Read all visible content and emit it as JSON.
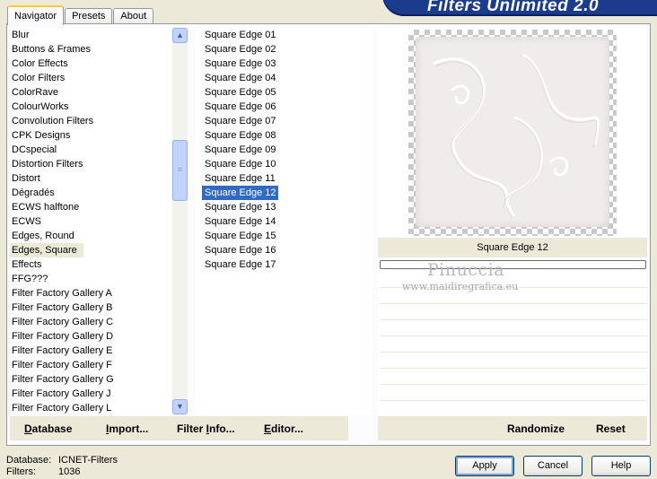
{
  "app": {
    "title": "Filters Unlimited 2.0"
  },
  "tabs": [
    {
      "label": "Navigator",
      "active": true
    },
    {
      "label": "Presets",
      "active": false
    },
    {
      "label": "About",
      "active": false
    }
  ],
  "categories": [
    "Blur",
    "Buttons & Frames",
    "Color Effects",
    "Color Filters",
    "ColorRave",
    "ColourWorks",
    "Convolution Filters",
    "CPK Designs",
    "DCspecial",
    "Distortion Filters",
    "Distort",
    "Dégradés",
    "ECWS halftone",
    "ECWS",
    "Edges, Round",
    "Edges, Square",
    "Effects",
    "FFG???",
    "Filter Factory Gallery A",
    "Filter Factory Gallery B",
    "Filter Factory Gallery C",
    "Filter Factory Gallery D",
    "Filter Factory Gallery E",
    "Filter Factory Gallery F",
    "Filter Factory Gallery G",
    "Filter Factory Gallery J",
    "Filter Factory Gallery L"
  ],
  "selected_category": "Edges, Square",
  "filters": [
    "Square Edge 01",
    "Square Edge 02",
    "Square Edge 03",
    "Square Edge 04",
    "Square Edge 05",
    "Square Edge 06",
    "Square Edge 07",
    "Square Edge 08",
    "Square Edge 09",
    "Square Edge 10",
    "Square Edge 11",
    "Square Edge 12",
    "Square Edge 13",
    "Square Edge 14",
    "Square Edge 15",
    "Square Edge 16",
    "Square Edge 17"
  ],
  "selected_filter": "Square Edge 12",
  "preview": {
    "filter_name": "Square Edge 12"
  },
  "watermark": {
    "name": "Pinuccia",
    "url": "www.maidiregrafica.eu"
  },
  "left_buttons": {
    "database": {
      "label": "Database",
      "accesskey": "D"
    },
    "import": {
      "label": "Import...",
      "accesskey": "I"
    },
    "filter_info": {
      "label": "Filter Info...",
      "accesskey": "I"
    },
    "editor": {
      "label": "Editor...",
      "accesskey": "E"
    }
  },
  "right_buttons": {
    "randomize": "Randomize",
    "reset": "Reset"
  },
  "footer": {
    "database_label": "Database:",
    "database_value": "ICNET-Filters",
    "filters_label": "Filters:",
    "filters_value": "1036"
  },
  "dialog_buttons": {
    "apply": "Apply",
    "cancel": "Cancel",
    "help": "Help"
  },
  "colors": {
    "selection": "#316AC5",
    "banner": "#1B3C8C",
    "window_bg": "#ECE9D8"
  },
  "icons": {
    "scroll_up": "▲",
    "scroll_down": "▼",
    "thumb_grip": "≡"
  }
}
